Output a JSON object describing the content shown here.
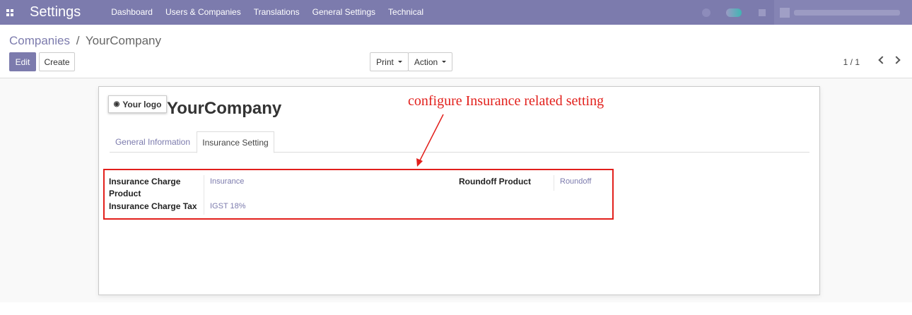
{
  "navbar": {
    "app_title": "Settings",
    "menu": [
      "Dashboard",
      "Users & Companies",
      "Translations",
      "General Settings",
      "Technical"
    ]
  },
  "control_panel": {
    "breadcrumb_parent": "Companies",
    "breadcrumb_separator": "/",
    "breadcrumb_current": "YourCompany",
    "edit_label": "Edit",
    "create_label": "Create",
    "print_label": "Print",
    "action_label": "Action",
    "pager": "1 / 1"
  },
  "form": {
    "logo_label": "Your logo",
    "company_name": "YourCompany",
    "tabs": [
      "General Information",
      "Insurance Setting"
    ],
    "active_tab": "Insurance Setting",
    "fields": {
      "insurance_charge_product_label": "Insurance Charge Product",
      "insurance_charge_product_value": "Insurance",
      "insurance_charge_tax_label": "Insurance Charge Tax",
      "insurance_charge_tax_value": "IGST 18%",
      "roundoff_product_label": "Roundoff Product",
      "roundoff_product_value": "Roundoff"
    }
  },
  "annotation": {
    "text": "configure Insurance related setting",
    "color": "#e2201c"
  },
  "colors": {
    "brand": "#7c7bad",
    "highlight": "#e2201c"
  }
}
